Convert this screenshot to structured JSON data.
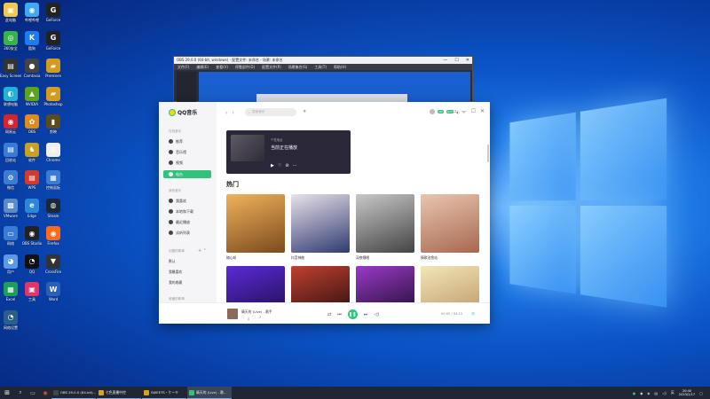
{
  "desktop": {
    "icons": [
      {
        "label": "此电脑",
        "color": "#f2c94c",
        "glyph": "▣"
      },
      {
        "label": "哔哩哔哩",
        "color": "#3fa7f5",
        "glyph": "◉"
      },
      {
        "label": "GeForce",
        "color": "#222222",
        "glyph": "G"
      },
      {
        "label": "360安全",
        "color": "#38b24a",
        "glyph": "◎"
      },
      {
        "label": "酷狗",
        "color": "#1b7df0",
        "glyph": "K"
      },
      {
        "label": "GeForce",
        "color": "#222222",
        "glyph": "G"
      },
      {
        "label": "Easy Screen",
        "color": "#333333",
        "glyph": "▤"
      },
      {
        "label": "Camtasia",
        "color": "#444444",
        "glyph": "●"
      },
      {
        "label": "Premiere",
        "color": "#d59b1f",
        "glyph": "▰"
      },
      {
        "label": "联想电脑",
        "color": "#25b0d8",
        "glyph": "◐"
      },
      {
        "label": "NVIDIA",
        "color": "#5aa51c",
        "glyph": "▲"
      },
      {
        "label": "Photoshop",
        "color": "#d59b1f",
        "glyph": "▰"
      },
      {
        "label": "网易云",
        "color": "#d8232a",
        "glyph": "◉"
      },
      {
        "label": "OBS",
        "color": "#e08c1a",
        "glyph": "✿"
      },
      {
        "label": "剪映",
        "color": "#5c4a1c",
        "glyph": "▮"
      },
      {
        "label": "回收站",
        "color": "#3a7bd5",
        "glyph": "▤"
      },
      {
        "label": "软件",
        "color": "#caa020",
        "glyph": "♞"
      },
      {
        "label": "Chrome",
        "color": "#eeeeee",
        "glyph": "◎"
      },
      {
        "label": "微信",
        "color": "#3a7bd5",
        "glyph": "⚙"
      },
      {
        "label": "WPS",
        "color": "#d33a2c",
        "glyph": "▤"
      },
      {
        "label": "控制面板",
        "color": "#3a7bd5",
        "glyph": "▦"
      },
      {
        "label": "VMware",
        "color": "#5a8bc8",
        "glyph": "▩"
      },
      {
        "label": "Edge",
        "color": "#2d86d8",
        "glyph": "e"
      },
      {
        "label": "Steam",
        "color": "#1b2838",
        "glyph": "◍"
      },
      {
        "label": "网络",
        "color": "#3a7bd5",
        "glyph": "▭"
      },
      {
        "label": "OBS Studio",
        "color": "#222222",
        "glyph": "◉"
      },
      {
        "label": "Firefox",
        "color": "#ff6a1a",
        "glyph": "◉"
      },
      {
        "label": "用户",
        "color": "#5a9ae8",
        "glyph": "◕"
      },
      {
        "label": "QQ",
        "color": "#111111",
        "glyph": "◔"
      },
      {
        "label": "CrossFire",
        "color": "#333333",
        "glyph": "▼"
      },
      {
        "label": "Excel",
        "color": "#1f9e5a",
        "glyph": "▦"
      },
      {
        "label": "工具",
        "color": "#e4356a",
        "glyph": "▣"
      },
      {
        "label": "Word",
        "color": "#2b5fb8",
        "glyph": "W"
      },
      {
        "label": "网络设置",
        "color": "#2a5f8a",
        "glyph": "◔"
      }
    ]
  },
  "obs": {
    "title": "OBS 29.0.0 (64-bit, windows) - 配置文件: 未命名 - 场景: 未命名",
    "menu": [
      "文件(F)",
      "编辑(E)",
      "查看(V)",
      "停靠部件(D)",
      "配置文件(P)",
      "场景集合(S)",
      "工具(T)",
      "帮助(H)"
    ]
  },
  "qq": {
    "app_name": "QQ音乐",
    "sections": {
      "online": "在线音乐",
      "mine": "我的音乐",
      "created": "创建的歌单",
      "collected": "收藏的歌单"
    },
    "nav": [
      {
        "label": "推荐"
      },
      {
        "label": "音乐馆"
      },
      {
        "label": "视频"
      },
      {
        "label": "电台"
      }
    ],
    "my_music": [
      {
        "label": "我喜欢"
      },
      {
        "label": "本地和下载"
      },
      {
        "label": "最近播放"
      },
      {
        "label": "试听列表"
      }
    ],
    "playlists": [
      "默认",
      "我最喜欢",
      "我的收藏"
    ],
    "search_placeholder": "搜索音乐",
    "banner": {
      "subtitle": "个性电台",
      "title": "当前正在播放"
    },
    "hot_title": "热门",
    "cards": [
      {
        "caption": "随心听",
        "c1": "#f0b35b",
        "c2": "#7b4a1e"
      },
      {
        "caption": "抖音神曲",
        "c1": "#e8e2ea",
        "c2": "#303a70"
      },
      {
        "caption": "深夜睡眠",
        "c1": "#c8c8c8",
        "c2": "#444444"
      },
      {
        "caption": "情歌治愈站",
        "c1": "#e8c6b0",
        "c2": "#a9674e"
      },
      {
        "caption": "",
        "c1": "#5b2ad8",
        "c2": "#180c40"
      },
      {
        "caption": "",
        "c1": "#c04030",
        "c2": "#1a0a0a"
      },
      {
        "caption": "",
        "c1": "#9a3ac8",
        "c2": "#12081e"
      },
      {
        "caption": "",
        "c1": "#f2e6b8",
        "c2": "#b89060"
      }
    ],
    "player": {
      "song": "晴天的 (Live) - 歌手",
      "time": "00:05 / 04:15",
      "lyric": "词"
    }
  },
  "taskbar": {
    "tasks": [
      {
        "label": "OBS 29.0.0 (64-bit)...",
        "color": "#444444"
      },
      {
        "label": "七色直播中控",
        "color": "#d8a020"
      },
      {
        "label": "SWEETS・ケーキ",
        "color": "#d8a020"
      },
      {
        "label": "晴天的 (Live) - 歌...",
        "color": "#31c27c"
      }
    ],
    "time": "20:40",
    "date": "2023/2/17"
  }
}
